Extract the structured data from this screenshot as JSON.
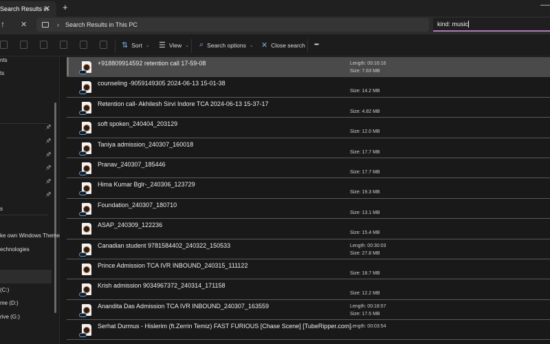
{
  "tab": {
    "title": "Search Results in",
    "close": "✕",
    "new_tab": "+"
  },
  "address": {
    "path": "Search Results in This PC",
    "chevron": "›"
  },
  "search": {
    "value": "kind: music",
    "accent": "#b07ab8"
  },
  "toolbar": {
    "sort": "Sort",
    "view": "View",
    "search_options": "Search options",
    "close_search": "Close search",
    "more": "•••"
  },
  "sidebar": {
    "items": [
      "nts",
      "ts",
      "",
      "",
      "",
      "",
      "",
      "",
      "s",
      "ke own Windows Theme",
      "echnologies",
      "",
      "(C:)",
      "me (D:)",
      "rive (G:)"
    ]
  },
  "files": [
    {
      "name": "+918809914592 retention call 17-59-08",
      "length": "Length: 00:16:16",
      "size": "Size: 7.63 MB",
      "cloud": true,
      "selected": true
    },
    {
      "name": "counseling -9059149305 2024-06-13 15-01-38",
      "size": "Size: 14.2 MB",
      "cloud": true
    },
    {
      "name": "Retention call- Akhilesh Sirvi Indore TCA 2024-06-13 15-37-17",
      "size": "Size: 4.82 MB",
      "cloud": true
    },
    {
      "name": "soft spoken_240404_203129",
      "size": "Size: 12.0 MB",
      "cloud": true
    },
    {
      "name": "Taniya admission_240307_160018",
      "size": "Size: 17.7 MB",
      "cloud": true
    },
    {
      "name": "Pranav_240307_185446",
      "size": "Size: 17.7 MB",
      "cloud": true
    },
    {
      "name": "Hima Kumar Bglr-_240306_123729",
      "size": "Size: 19.3 MB",
      "cloud": true
    },
    {
      "name": "Foundation_240307_180710",
      "size": "Size: 13.1 MB",
      "cloud": true
    },
    {
      "name": "ASAP_240309_122236",
      "size": "Size: 15.4 MB",
      "cloud": false
    },
    {
      "name": "Canadian student 9781584402_240322_150533",
      "length": "Length: 00:30:03",
      "size": "Size: 27.8 MB",
      "cloud": true
    },
    {
      "name": "Prince Admission TCA IVR INBOUND_240315_111122",
      "size": "Size: 18.7 MB",
      "cloud": false
    },
    {
      "name": "Krish  admission 9034967372_240314_171158",
      "size": "Size: 12.2 MB",
      "cloud": true
    },
    {
      "name": "Anandita Das Admission TCA IVR INBOUND_240307_163559",
      "length": "Length: 00:18:57",
      "size": "Size: 17.5 MB",
      "cloud": true
    },
    {
      "name": "Serhat Durmus - Hislerim (ft.Zerrin Temiz) FAST FURIOUS [Chase Scene] [TubeRipper.com]",
      "length": "Length: 00:03:54",
      "cloud": true
    }
  ]
}
